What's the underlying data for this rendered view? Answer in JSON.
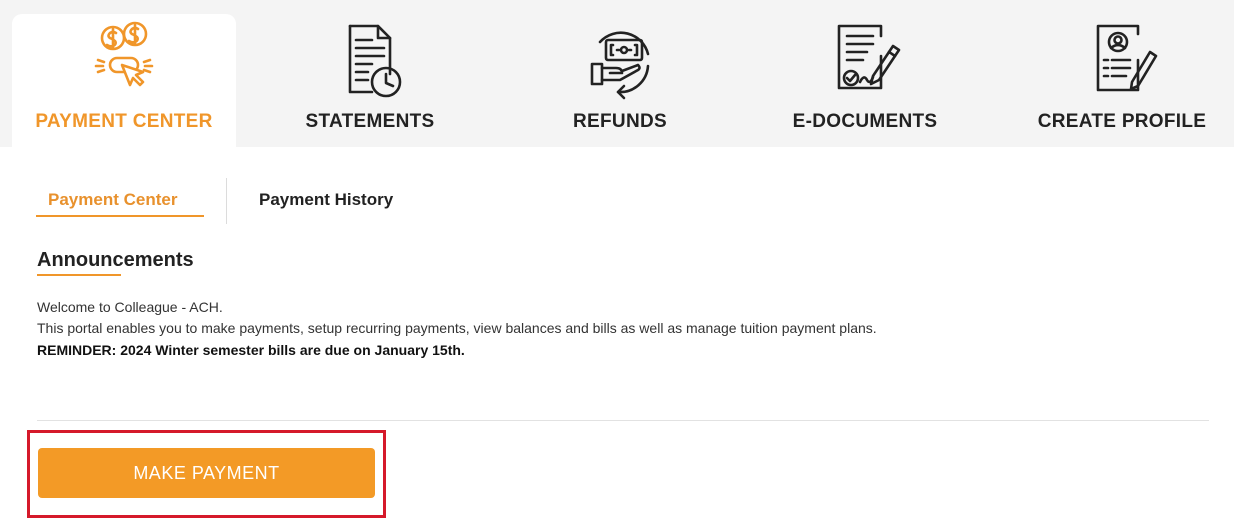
{
  "tabs": [
    {
      "label": "PAYMENT CENTER",
      "icon": "payment-center-icon",
      "active": true
    },
    {
      "label": "STATEMENTS",
      "icon": "statements-icon",
      "active": false
    },
    {
      "label": "REFUNDS",
      "icon": "refunds-icon",
      "active": false
    },
    {
      "label": "E-DOCUMENTS",
      "icon": "e-documents-icon",
      "active": false
    },
    {
      "label": "CREATE PROFILE",
      "icon": "create-profile-icon",
      "active": false
    }
  ],
  "subtabs": {
    "payment_center": "Payment Center",
    "payment_history": "Payment History"
  },
  "announcements": {
    "title": "Announcements",
    "line1": "Welcome to Colleague - ACH.",
    "line2": "This portal enables you to make payments, setup recurring payments, view balances and bills as well as manage tuition payment plans.",
    "reminder": "REMINDER: 2024 Winter semester bills are due on January 15th."
  },
  "actions": {
    "make_payment": "MAKE PAYMENT"
  },
  "colors": {
    "accent": "#f0962a",
    "highlight_border": "#d5192a",
    "button": "#f39a26"
  }
}
